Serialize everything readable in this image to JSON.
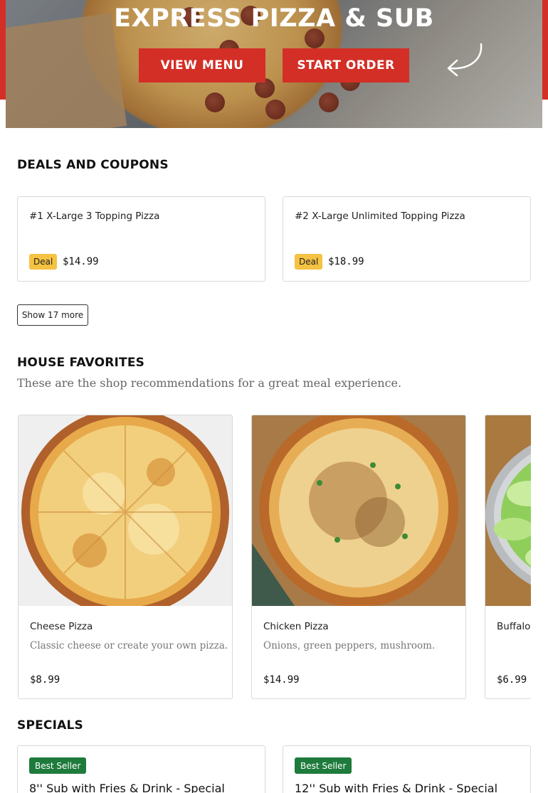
{
  "hero": {
    "title": "EXPRESS PIZZA & SUB",
    "view_menu_label": "VIEW MENU",
    "start_order_label": "START ORDER"
  },
  "deals": {
    "heading": "DEALS AND COUPONS",
    "items": [
      {
        "title": "#1 X-Large 3 Topping Pizza",
        "badge": "Deal",
        "price": "$14.99"
      },
      {
        "title": "#2 X-Large Unlimited Topping Pizza",
        "badge": "Deal",
        "price": "$18.99"
      }
    ],
    "show_more_label": "Show 17 more"
  },
  "favorites": {
    "heading": "HOUSE FAVORITES",
    "subtitle": "These are the shop recommendations for a great meal experience.",
    "items": [
      {
        "name": "Cheese Pizza",
        "description": "Classic cheese or create your own pizza.",
        "price": "$8.99"
      },
      {
        "name": "Chicken Pizza",
        "description": "Onions, green peppers, mushroom.",
        "price": "$14.99"
      },
      {
        "name": "Buffalo",
        "description": "",
        "price": "$6.99"
      }
    ]
  },
  "specials": {
    "heading": "SPECIALS",
    "items": [
      {
        "badge": "Best Seller",
        "title": "8'' Sub with Fries & Drink - Special"
      },
      {
        "badge": "Best Seller",
        "title": "12'' Sub with Fries & Drink - Special"
      }
    ]
  },
  "colors": {
    "brand_red": "#d32f26",
    "deal_badge": "#f5c242",
    "best_seller_badge": "#1e7b3c"
  }
}
